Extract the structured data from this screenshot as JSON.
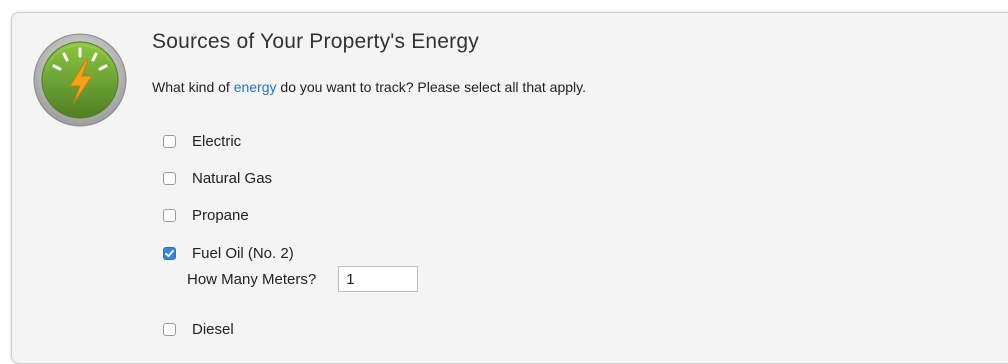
{
  "section": {
    "title": "Sources of Your Property's Energy",
    "question_prefix": "What kind of ",
    "question_link": "energy",
    "question_suffix": " do you want to track? Please select all that apply."
  },
  "colors": {
    "link": "#2a73c4",
    "checkbox_checked": "#3b84d6",
    "badge_green": "#6aa033",
    "badge_bolt": "#f3a21b"
  },
  "icons": {
    "badge": "lightning-bolt-gauge-icon"
  },
  "options": [
    {
      "label": "Electric",
      "checked": false
    },
    {
      "label": "Natural Gas",
      "checked": false
    },
    {
      "label": "Propane",
      "checked": false
    },
    {
      "label": "Fuel Oil (No. 2)",
      "checked": true
    },
    {
      "label": "Diesel",
      "checked": false
    }
  ],
  "meters": {
    "label": "How Many Meters?",
    "value": "1"
  }
}
